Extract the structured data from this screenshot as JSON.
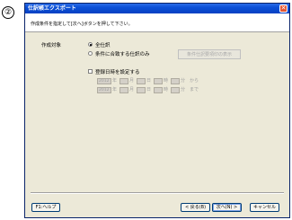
{
  "step_marker": "②",
  "window": {
    "title": "仕訳帳エクスポート",
    "close_glyph": "✕"
  },
  "header": {
    "instruction": "作成条件を指定して[次へ]ボタンを押して下さい。"
  },
  "form": {
    "target_label": "作成対象",
    "radio_all": "全仕訳",
    "radio_condition": "条件に合致する仕訳のみ",
    "condition_button": "条件仕訳要項印の表示",
    "register_date_checkbox": "登録日時を設定する",
    "from_row": {
      "year": "2012",
      "y": "年",
      "m": "月",
      "d": "日",
      "h": "時",
      "min": "分",
      "suffix": "から"
    },
    "to_row": {
      "year": "2012",
      "y": "年",
      "m": "月",
      "d": "日",
      "h": "時",
      "min": "分",
      "suffix": "まで"
    }
  },
  "footer": {
    "help": "F1:ヘルプ",
    "back": "< 戻る(B)",
    "next": "次へ(N) >",
    "cancel": "キャンセル"
  }
}
